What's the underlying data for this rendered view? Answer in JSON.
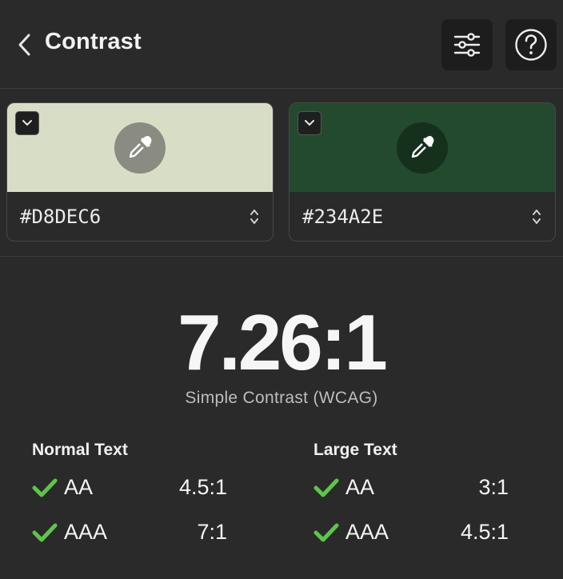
{
  "header": {
    "title": "Contrast",
    "back_icon": "chevron-left-icon",
    "settings_icon": "sliders-icon",
    "help_icon": "help-circle-icon"
  },
  "colors": {
    "foreground": {
      "hex": "#D8DEC6",
      "swatch": "#D8DEC6",
      "picker_circle": "#8A8C82"
    },
    "background": {
      "hex": "#234A2E",
      "swatch": "#234A2E",
      "picker_circle": "#16301E"
    }
  },
  "result": {
    "ratio": "7.26:1",
    "method": "Simple Contrast (WCAG)"
  },
  "normal_text": {
    "heading": "Normal Text",
    "rows": [
      {
        "level": "AA",
        "ratio": "4.5:1",
        "pass": true
      },
      {
        "level": "AAA",
        "ratio": "7:1",
        "pass": true
      }
    ]
  },
  "large_text": {
    "heading": "Large Text",
    "rows": [
      {
        "level": "AA",
        "ratio": "3:1",
        "pass": true
      },
      {
        "level": "AAA",
        "ratio": "4.5:1",
        "pass": true
      }
    ]
  },
  "theme": {
    "pass_color": "#5cc64a",
    "panel_bg": "#2a2a2a"
  }
}
